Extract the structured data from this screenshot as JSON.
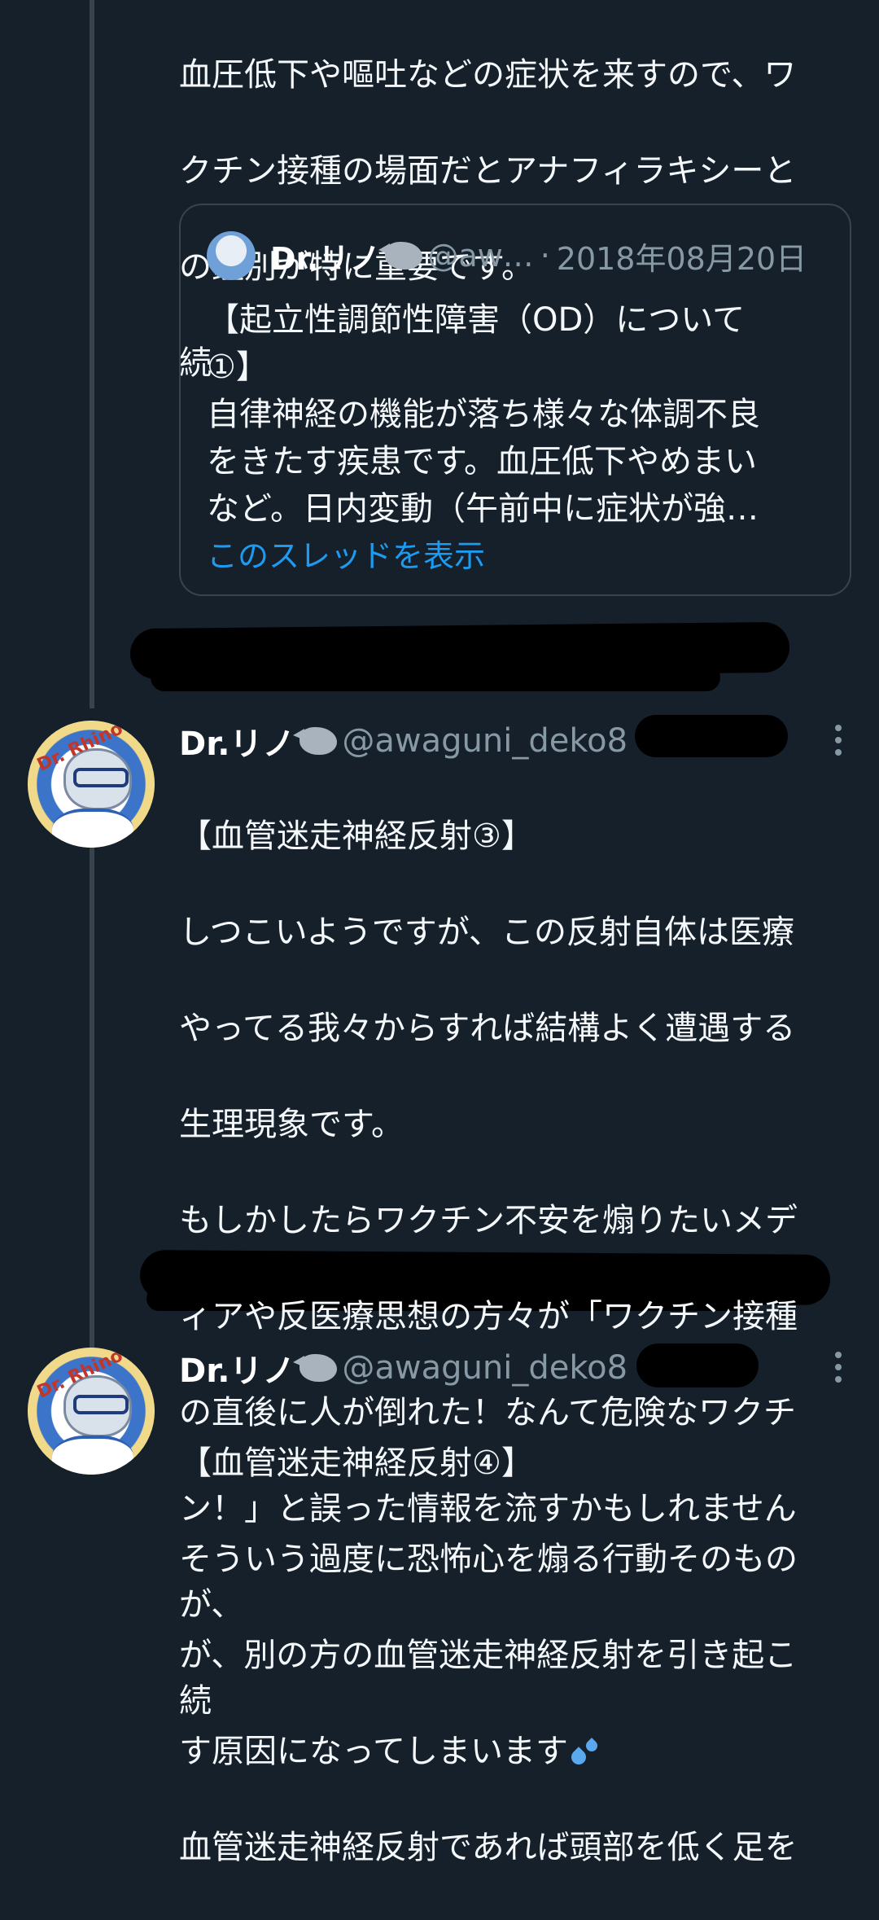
{
  "tweet1": {
    "lines": [
      "血圧低下や嘔吐などの症状を来すので、ワ",
      "クチン接種の場面だとアナフィラキシーと",
      "の鑑別が特に重要です。",
      "続"
    ]
  },
  "quote": {
    "name": "Dr.リノ",
    "handle": "@aw…",
    "sep": "·",
    "date": "2018年08月20日",
    "lines": [
      "【起立性調節性障害（OD）について",
      "①】",
      "自律神経の機能が落ち様々な体調不良",
      "をきたす疾患です。血圧低下やめまい",
      "など。日内変動（午前中に症状が強…"
    ],
    "link": "このスレッドを表示"
  },
  "tweet2": {
    "name": "Dr.リノ",
    "handle": "@awaguni_deko8",
    "sep": "·",
    "avatar_text": "Dr. Rhino",
    "lines": [
      "【血管迷走神経反射③】",
      "しつこいようですが、この反射自体は医療",
      "やってる我々からすれば結構よく遭遇する",
      "生理現象です。",
      "もしかしたらワクチン不安を煽りたいメデ",
      "ィアや反医療思想の方々が「ワクチン接種",
      "の直後に人が倒れた！なんて危険なワクチ",
      "ン！」と誤った情報を流すかもしれません",
      "が、",
      "続"
    ]
  },
  "tweet3": {
    "name": "Dr.リノ",
    "handle": "@awaguni_deko8",
    "sep": "·",
    "avatar_text": "Dr. Rhino",
    "lines": [
      "【血管迷走神経反射④】",
      "そういう過度に恐怖心を煽る行動そのもの",
      "が、別の方の血管迷走神経反射を引き起こ",
      "す原因になってしまいます",
      "血管迷走神経反射であれば頭部を低く足を"
    ]
  },
  "icons": [
    "rhino-emoji-icon",
    "sweat-droplets-icon",
    "more-options-icon"
  ],
  "colors": {
    "background": "#15202b",
    "link": "#1d9bf0",
    "secondary": "#8899a6",
    "border": "#38444d"
  }
}
